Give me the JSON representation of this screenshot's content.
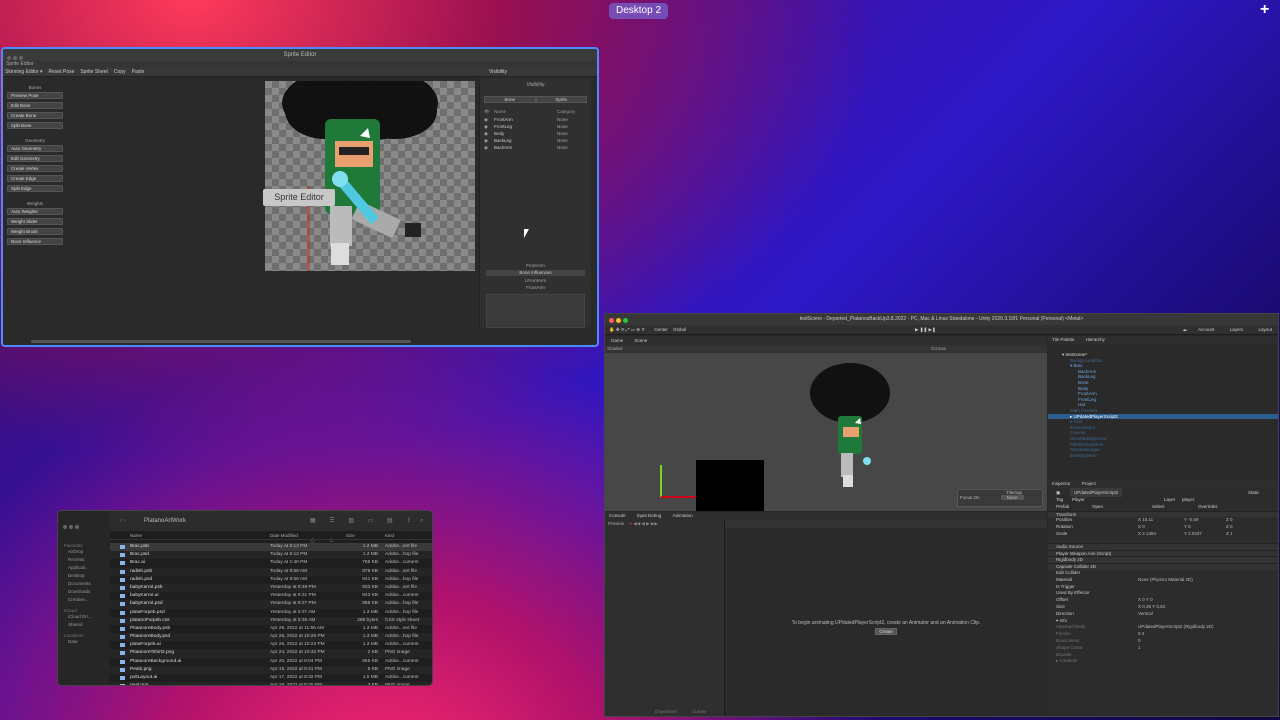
{
  "desktop": {
    "label": "Desktop 2"
  },
  "sprite_editor": {
    "title": "Sprite Editor",
    "tab": "Sprite Editor",
    "toolbar": [
      "Skinning Editor ▾",
      "Reset Pose",
      "Sprite Sheet",
      "Copy",
      "Paste"
    ],
    "toolbar_right": "Visibility",
    "groups": [
      {
        "title": "Bones",
        "tools": [
          "Preview Pose",
          "Edit Bone",
          "Create Bone",
          "Split Bone"
        ]
      },
      {
        "title": "Geometry",
        "tools": [
          "Auto Geometry",
          "Edit Geometry",
          "Create Vertex",
          "Create Edge",
          "Split Edge"
        ]
      },
      {
        "title": "Weights",
        "tools": [
          "Auto Weights",
          "Weight Slider",
          "Weight Brush",
          "Bone Influence"
        ]
      }
    ],
    "tooltip": "Sprite Editor",
    "visibility": {
      "title": "Visibility",
      "tabs": [
        "Bone",
        "Sprite"
      ],
      "columns": [
        "Name",
        "Category"
      ],
      "rows": [
        {
          "name": "FrontArm",
          "category": "None"
        },
        {
          "name": "FrontLeg",
          "category": "None"
        },
        {
          "name": "Body",
          "category": "None"
        },
        {
          "name": "BackLeg",
          "category": "None"
        },
        {
          "name": "BackArm",
          "category": "None"
        }
      ],
      "footer_label1": "FrontArm",
      "footer_button": "Bone Influences",
      "footer_label2": "LFrontArm",
      "footer_label3": "FrontArm"
    }
  },
  "finder": {
    "folder": "PlatanoArtWork",
    "sidebar": {
      "favorites_title": "Favorites",
      "favorites": [
        "AirDrop",
        "Recents",
        "Applicati...",
        "Desktop",
        "Documents",
        "Downloads",
        "Creative..."
      ],
      "icloud_title": "iCloud",
      "icloud": [
        "iCloud Dri...",
        "Shared"
      ],
      "locations_title": "Locations",
      "locations": [
        "Data"
      ]
    },
    "columns": {
      "name": "Name",
      "date": "Date Modified",
      "size": "Size",
      "kind": "Kind"
    },
    "files": [
      {
        "name": "Brac.psb",
        "date": "Today at 5:13 PM",
        "size": "1.2 MB",
        "kind": "Adobe...ent file"
      },
      {
        "name": "Brac.psd",
        "date": "Today at 5:12 PM",
        "size": "1.3 MB",
        "kind": "Adobe...hop file"
      },
      {
        "name": "Brac.ai",
        "date": "Today at 1:40 PM",
        "size": "766 KB",
        "kind": "Adobe...cument"
      },
      {
        "name": "radish.psb",
        "date": "Today at 9:58 AM",
        "size": "879 KB",
        "kind": "Adobe...ent file"
      },
      {
        "name": "radish.psd",
        "date": "Today at 9:58 AM",
        "size": "841 KB",
        "kind": "Adobe...hop file"
      },
      {
        "name": "babyKarrot.psb",
        "date": "Yesterday at 8:48 PM",
        "size": "833 KB",
        "kind": "Adobe...ent file"
      },
      {
        "name": "babyKarrot.ai",
        "date": "Yesterday at 8:31 PM",
        "size": "843 KB",
        "kind": "Adobe...cument"
      },
      {
        "name": "babyKarrot.psd",
        "date": "Yesterday at 8:27 PM",
        "size": "858 KB",
        "kind": "Adobe...hop file"
      },
      {
        "name": "plataForpeb.psd",
        "date": "Yesterday at 5:37 AM",
        "size": "1.3 MB",
        "kind": "Adobe...hop file"
      },
      {
        "name": "platanoForpeb.css",
        "date": "Yesterday at 5:35 AM",
        "size": "289 bytes",
        "kind": "CSS style sheet"
      },
      {
        "name": "PlatanoreBody.psb",
        "date": "Apr 29, 2022 at 11:56 AM",
        "size": "1.3 MB",
        "kind": "Adobe...ent file"
      },
      {
        "name": "PlatanoreBody.psd",
        "date": "Apr 28, 2022 at 10:26 PM",
        "size": "1.3 MB",
        "kind": "Adobe...hop file"
      },
      {
        "name": "plataForpeb.ai",
        "date": "Apr 28, 2022 at 10:23 PM",
        "size": "1.3 MB",
        "kind": "Adobe...cument"
      },
      {
        "name": "PlatanoreTshirt2.png",
        "date": "Apr 24, 2022 at 10:42 PM",
        "size": "2 KB",
        "kind": "PNG image"
      },
      {
        "name": "PlatanoreBackground.ai",
        "date": "Apr 20, 2022 at 9:04 PM",
        "size": "865 KB",
        "kind": "Adobe...cument"
      },
      {
        "name": "Peal2.png",
        "date": "Apr 19, 2022 at 8:41 PM",
        "size": "5 KB",
        "kind": "PNG image"
      },
      {
        "name": "poltLayout.ai",
        "date": "Apr 17, 2022 at 8:32 PM",
        "size": "1.5 MB",
        "kind": "Adobe...cument"
      },
      {
        "name": "peal.png",
        "date": "Apr 16, 2022 at 8:25 PM",
        "size": "3 KB",
        "kind": "PNG image"
      }
    ]
  },
  "unity": {
    "title": "testScene - Deported_PlatanosBackUp3.8.2022 - PC, Mac & Linux Standalone - Unity 2020.3.16f1 Personal (Personal) <Metal>",
    "toolbar": {
      "pivot": "Center",
      "space": "Global",
      "account": "Account",
      "layers": "Layers",
      "layout": "Layout"
    },
    "scene_tabs": [
      "Game",
      "Scene"
    ],
    "scene_shading": "Shaded",
    "scene_gizmos": "Gizmos",
    "tilemap": {
      "label": "Tilemap",
      "focus_label": "Focus On",
      "focus_value": "None"
    },
    "bottom_tabs": [
      "Console",
      "Input Debug",
      "Animation"
    ],
    "anim_preview": "Preview",
    "anim_message": "To begin animating UPdatedPlayerScript2, create an Animator and an Animation Clip.",
    "anim_create": "Create",
    "anim_bottom": [
      "Dopesheet",
      "Curves"
    ],
    "hier_tabs": [
      "Tile Palette",
      "Hierarchy"
    ],
    "hierarchy": [
      {
        "text": "▾ testScene*",
        "style": "white",
        "indent": 0
      },
      {
        "text": "BackgroundCat",
        "style": "dim",
        "indent": 2
      },
      {
        "text": "▾ Brac",
        "style": "",
        "indent": 2
      },
      {
        "text": "BackArm",
        "style": "",
        "indent": 4
      },
      {
        "text": "BackLeg",
        "style": "",
        "indent": 4
      },
      {
        "text": "Bone",
        "style": "",
        "indent": 4
      },
      {
        "text": "Body",
        "style": "",
        "indent": 4
      },
      {
        "text": "FrontArm",
        "style": "",
        "indent": 4
      },
      {
        "text": "FrontLeg",
        "style": "",
        "indent": 4
      },
      {
        "text": "Hat",
        "style": "",
        "indent": 4
      },
      {
        "text": "Main Camera",
        "style": "dim",
        "indent": 2
      },
      {
        "text": "▸ UPdatedPlayerScript2",
        "style": "sel",
        "indent": 2
      },
      {
        "text": "▸ Grid",
        "style": "dim",
        "indent": 2
      },
      {
        "text": "Environment",
        "style": "dim",
        "indent": 2
      },
      {
        "text": "Canvas",
        "style": "dim",
        "indent": 2
      },
      {
        "text": "GreenBackground",
        "style": "dim",
        "indent": 2
      },
      {
        "text": "PlantPickUpItem",
        "style": "dim",
        "indent": 2
      },
      {
        "text": "GameManager",
        "style": "dim",
        "indent": 2
      },
      {
        "text": "EventSystem",
        "style": "dim",
        "indent": 2
      }
    ],
    "insp_tabs": [
      "Inspector",
      "Project"
    ],
    "inspector": {
      "object_name": "UPdatedPlayerScript2",
      "static": "Static",
      "tag_label": "Tag",
      "tag": "Player",
      "layer_label": "Layer",
      "layer": "player",
      "prefab_label": "Prefab",
      "open": "Open",
      "select": "Select",
      "overrides": "Overrides",
      "transform": "Transform",
      "position": {
        "label": "Position",
        "x": "X 10.11",
        "y": "Y -0.69",
        "z": "Z 0"
      },
      "rotation": {
        "label": "Rotation",
        "x": "X 0",
        "y": "Y 0",
        "z": "Z 0"
      },
      "scale": {
        "label": "Scale",
        "x": "X 2.1384",
        "y": "Y 2.0437",
        "z": "Z 1"
      },
      "components": [
        "Audio Source",
        "Player Weapon Aim (Script)",
        "Rigidbody 2D",
        "Capsule Collider 2D"
      ],
      "collider": [
        {
          "label": "Edit Collider",
          "value": ""
        },
        {
          "label": "Material",
          "value": "None (Physics Material 2D)"
        },
        {
          "label": "Is Trigger",
          "value": ""
        },
        {
          "label": "Used By Effector",
          "value": ""
        },
        {
          "label": "Offset",
          "value": "X 0    Y 0"
        },
        {
          "label": "Size",
          "value": "X 0.38    Y 0.63"
        },
        {
          "label": "Direction",
          "value": "Vertical"
        },
        {
          "label": "▾ Info",
          "value": ""
        },
        {
          "label": "Attached Body",
          "value": "UPdatedPlayerScript2 (Rigidbody 2D)"
        },
        {
          "label": "Friction",
          "value": "0.4"
        },
        {
          "label": "Bounciness",
          "value": "0"
        },
        {
          "label": "Shape Count",
          "value": "1"
        },
        {
          "label": "Bounds",
          "value": ""
        },
        {
          "label": "▸ Contacts",
          "value": ""
        }
      ]
    }
  }
}
